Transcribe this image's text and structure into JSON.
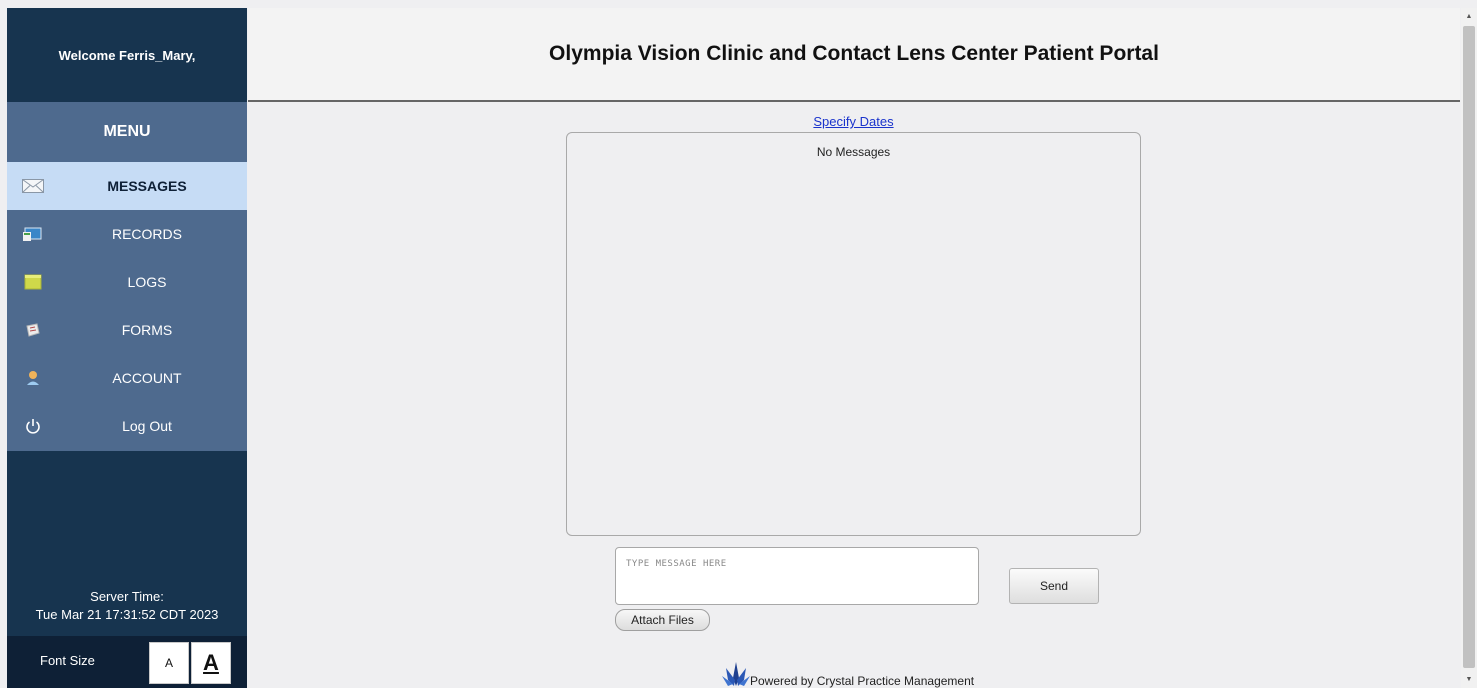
{
  "sidebar": {
    "welcome": "Welcome Ferris_Mary,",
    "menu_title": "MENU",
    "items": [
      {
        "label": "MESSAGES",
        "icon": "envelope-icon",
        "active": true
      },
      {
        "label": "RECORDS",
        "icon": "records-icon",
        "active": false
      },
      {
        "label": "LOGS",
        "icon": "folder-icon",
        "active": false
      },
      {
        "label": "FORMS",
        "icon": "forms-icon",
        "active": false
      },
      {
        "label": "ACCOUNT",
        "icon": "user-icon",
        "active": false
      },
      {
        "label": "Log Out",
        "icon": "power-icon",
        "active": false
      }
    ],
    "server_time_label": "Server Time:",
    "server_time_value": "Tue Mar 21 17:31:52 CDT 2023",
    "font_size_label": "Font Size",
    "font_small": "A",
    "font_large": "A"
  },
  "header": {
    "title": "Olympia Vision Clinic and Contact Lens Center Patient Portal"
  },
  "main": {
    "specify_dates": "Specify Dates",
    "empty_text": "No Messages",
    "message_placeholder": "TYPE MESSAGE HERE",
    "send_label": "Send",
    "attach_label": "Attach Files",
    "powered_by": "Powered by Crystal Practice Management"
  },
  "colors": {
    "sidebar_dark": "#17344f",
    "menu_bg": "#4e6a8e",
    "active_item": "#c6dcf5",
    "link": "#1a33cc"
  }
}
